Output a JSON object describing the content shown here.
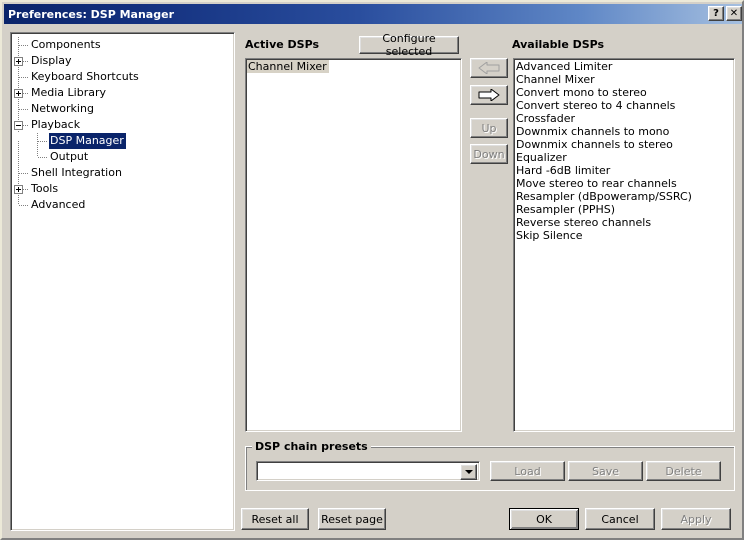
{
  "window": {
    "title": "Preferences: DSP Manager",
    "help_button": "?",
    "close_button": "✕"
  },
  "sidebar": {
    "items": [
      {
        "label": "Components",
        "level": 1,
        "expander": "none",
        "selected": false
      },
      {
        "label": "Display",
        "level": 1,
        "expander": "plus",
        "selected": false
      },
      {
        "label": "Keyboard Shortcuts",
        "level": 1,
        "expander": "none",
        "selected": false
      },
      {
        "label": "Media Library",
        "level": 1,
        "expander": "plus",
        "selected": false
      },
      {
        "label": "Networking",
        "level": 1,
        "expander": "none",
        "selected": false
      },
      {
        "label": "Playback",
        "level": 1,
        "expander": "minus",
        "selected": false
      },
      {
        "label": "DSP Manager",
        "level": 2,
        "expander": "none",
        "selected": true
      },
      {
        "label": "Output",
        "level": 2,
        "expander": "none",
        "selected": false
      },
      {
        "label": "Shell Integration",
        "level": 1,
        "expander": "none",
        "selected": false
      },
      {
        "label": "Tools",
        "level": 1,
        "expander": "plus",
        "selected": false
      },
      {
        "label": "Advanced",
        "level": 1,
        "expander": "none",
        "selected": false
      }
    ]
  },
  "main": {
    "active_dsps": {
      "label": "Active DSPs",
      "configure_button": "Configure selected",
      "items": [
        {
          "label": "Channel Mixer",
          "selected": true
        }
      ]
    },
    "transfer_buttons": {
      "remove_label": "⇐",
      "add_label": "⇒",
      "up_label": "Up",
      "down_label": "Down",
      "remove_enabled": false,
      "add_enabled": true,
      "up_enabled": false,
      "down_enabled": false
    },
    "available_dsps": {
      "label": "Available DSPs",
      "items": [
        "Advanced Limiter",
        "Channel Mixer",
        "Convert mono to stereo",
        "Convert stereo to 4 channels",
        "Crossfader",
        "Downmix channels to mono",
        "Downmix channels to stereo",
        "Equalizer",
        "Hard -6dB limiter",
        "Move stereo to rear channels",
        "Resampler (dBpoweramp/SSRC)",
        "Resampler (PPHS)",
        "Reverse stereo channels",
        "Skip Silence"
      ]
    },
    "presets": {
      "group_title": "DSP chain presets",
      "combo_value": "",
      "load_label": "Load",
      "save_label": "Save",
      "delete_label": "Delete"
    }
  },
  "footer": {
    "reset_all_label": "Reset all",
    "reset_page_label": "Reset page",
    "ok_label": "OK",
    "cancel_label": "Cancel",
    "apply_label": "Apply"
  },
  "colors": {
    "face": "#d4d0c8",
    "title_start": "#0a246a",
    "title_end": "#a6c0e0",
    "selection": "#0a246a",
    "selection_inactive": "#d7d2c6",
    "disabled_text": "#808080"
  }
}
